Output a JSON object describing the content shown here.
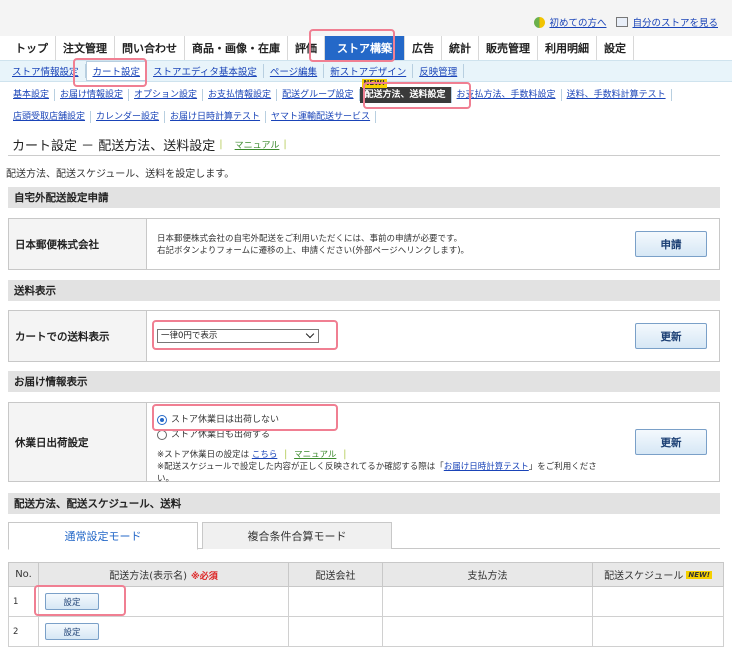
{
  "util_links": [
    {
      "label": "初めての方へ",
      "icon": "guide-icon"
    },
    {
      "label": "自分のストアを見る",
      "icon": "store-window-icon"
    }
  ],
  "main_tabs": [
    {
      "label": "トップ",
      "active": false
    },
    {
      "label": "注文管理",
      "active": false
    },
    {
      "label": "問い合わせ",
      "active": false
    },
    {
      "label": "商品・画像・在庫",
      "active": false
    },
    {
      "label": "評価",
      "active": false
    },
    {
      "label": "ストア構築",
      "active": true
    },
    {
      "label": "広告",
      "active": false
    },
    {
      "label": "統計",
      "active": false
    },
    {
      "label": "販売管理",
      "active": false
    },
    {
      "label": "利用明細",
      "active": false
    },
    {
      "label": "設定",
      "active": false
    }
  ],
  "submenu1": [
    "ストア情報設定",
    "カート設定",
    "ストアエディタ基本設定",
    "ページ編集",
    "新ストアデザイン",
    "反映管理"
  ],
  "submenu1_current": 1,
  "submenu2_row1": [
    "基本設定",
    "お届け情報設定",
    "オプション設定",
    "お支払情報設定",
    "配送グループ設定",
    "配送方法、送料設定",
    "お支払方法、手数料設定",
    "送料、手数料計算テスト"
  ],
  "submenu2_row2": [
    "店頭受取店舗設定",
    "カレンダー設定",
    "お届け日時計算テスト",
    "ヤマト運輸配送サービス"
  ],
  "submenu2_new_badge": "NEW!",
  "page": {
    "title": "カート設定 － 配送方法、送料設定",
    "manual": "マニュアル",
    "description": "配送方法、配送スケジュール、送料を設定します。"
  },
  "section_delivery_apply": {
    "header": "自宅外配送設定申請",
    "label": "日本郵便株式会社",
    "text_line1": "日本郵便株式会社の自宅外配送をご利用いただくには、事前の申請が必要です。",
    "text_line2": "右記ボタンよりフォームに遷移の上、申請ください(外部ページへリンクします)。",
    "button": "申請"
  },
  "section_shipping_display": {
    "header": "送料表示",
    "label": "カートでの送料表示",
    "select_value": "一律0円で表示",
    "button": "更新"
  },
  "section_delivery_info": {
    "header": "お届け情報表示",
    "label": "休業日出荷設定",
    "radio1": "ストア休業日は出荷しない",
    "radio2": "ストア休業日も出荷する",
    "radio_selected": 0,
    "note1_prefix": "※ストア休業日の設定は",
    "note1_link": "こちら",
    "note1_manual": "マニュアル",
    "note2_prefix": "※配送スケジュールで設定した内容が正しく反映されてるか確認する際は「",
    "note2_link": "お届け日時計算テスト",
    "note2_suffix": "」をご利用ください。",
    "button": "更新"
  },
  "section_methods": {
    "header": "配送方法、配送スケジュール、送料"
  },
  "mode_tabs": [
    {
      "label": "通常設定モード",
      "active": true
    },
    {
      "label": "複合条件合算モード",
      "active": false
    }
  ],
  "table": {
    "headers": [
      "No.",
      "配送方法(表示名)",
      "配送会社",
      "支払方法",
      "配送スケジュール"
    ],
    "required_mark": "※必須",
    "new_badge": "NEW!",
    "rows": [
      {
        "no": "1",
        "button": "設定"
      },
      {
        "no": "2",
        "button": "設定"
      }
    ]
  },
  "colors": {
    "accent": "#2468c8",
    "highlight": "#f07f92",
    "required": "#dd2222"
  }
}
